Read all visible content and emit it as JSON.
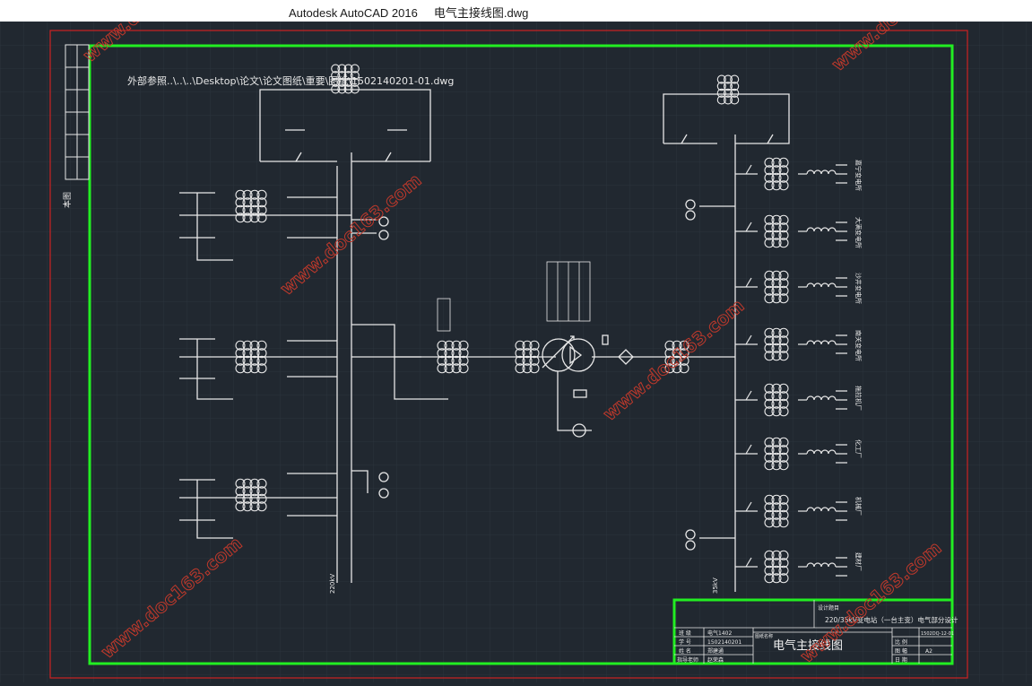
{
  "window": {
    "app_title": "Autodesk AutoCAD 2016",
    "file_name": "电气主接线图.dwg"
  },
  "drawing": {
    "xref_label": "外部参照..\\..\\..\\Desktop\\论文\\论文图纸\\重要\\图纸\\1502140201-01.dwg",
    "left_bus_label": "220kV",
    "right_bus_label": "35kV",
    "side_label": "本图",
    "feeders": [
      {
        "name": "嘉宁变电所"
      },
      {
        "name": "大满变电所"
      },
      {
        "name": "沙井变电所"
      },
      {
        "name": "南关变电所"
      },
      {
        "name": "拖拉机厂"
      },
      {
        "name": "化工厂"
      },
      {
        "name": "机械厂"
      },
      {
        "name": "建材厂"
      }
    ]
  },
  "title_block": {
    "project_header": "设计题目",
    "project_title": "220/35kV变电站（一台主变）电气部分设计",
    "drawing_title": "电气主接线图",
    "class_label": "班 级",
    "class_value": "电气1402",
    "student_id_label": "学 号",
    "student_id_value": "1502140201",
    "name_label": "姓 名",
    "name_value": "郑建通",
    "advisor_label": "指导老师",
    "advisor_value": "赵荣森",
    "drawing_no": "1502DQ-12-01",
    "scale_label": "比 例",
    "size_label": "图 幅",
    "size_value": "A2",
    "date_label": "日 期",
    "sub_header": "图纸名称"
  },
  "watermarks": [
    "www.doc163.com"
  ],
  "colors": {
    "background": "#212830",
    "grid": "#2b333d",
    "frame_green": "#22ee22",
    "frame_red": "#cc2222",
    "lines": "#e8e8e8",
    "watermark": "#c0392b"
  }
}
